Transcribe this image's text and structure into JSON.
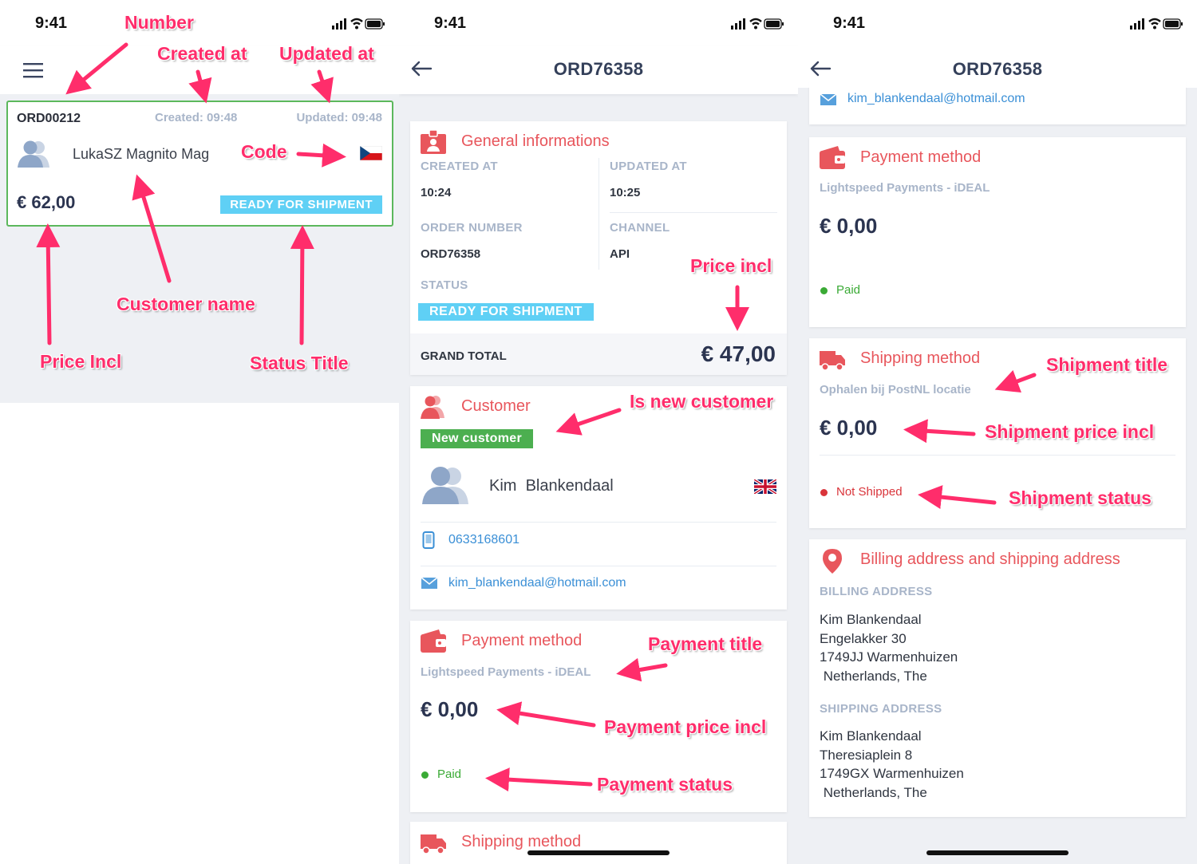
{
  "status_bar": {
    "time": "9:41"
  },
  "screen1": {
    "order_card": {
      "number": "ORD00212",
      "created": "Created: 09:48",
      "updated": "Updated: 09:48",
      "customer_name": "LukaSZ Magnito Mag",
      "price": "€ 62,00",
      "status": "READY FOR SHIPMENT"
    }
  },
  "screen2": {
    "title": "ORD76358",
    "general": {
      "title": "General informations",
      "created_label": "CREATED AT",
      "created_value": "10:24",
      "updated_label": "UPDATED AT",
      "updated_value": "10:25",
      "order_number_label": "ORDER NUMBER",
      "order_number_value": "ORD76358",
      "channel_label": "CHANNEL",
      "channel_value": "API",
      "status_label": "STATUS",
      "status_value": "READY FOR SHIPMENT",
      "grand_total_label": "GRAND TOTAL",
      "grand_total_value": "€ 47,00"
    },
    "customer": {
      "title": "Customer",
      "new_badge": "New customer",
      "first_name": "Kim",
      "last_name": "Blankendaal",
      "phone": "0633168601",
      "email": "kim_blankendaal@hotmail.com"
    },
    "payment": {
      "title": "Payment method",
      "provider": "Lightspeed Payments - iDEAL",
      "price": "€ 0,00",
      "status": "Paid"
    },
    "shipping": {
      "title": "Shipping method"
    }
  },
  "screen3": {
    "title": "ORD76358",
    "email": "kim_blankendaal@hotmail.com",
    "payment": {
      "title": "Payment method",
      "provider": "Lightspeed Payments - iDEAL",
      "price": "€ 0,00",
      "status": "Paid"
    },
    "shipping": {
      "title": "Shipping method",
      "provider": "Ophalen bij PostNL locatie",
      "price": "€ 0,00",
      "status": "Not Shipped"
    },
    "address": {
      "title": "Billing address and shipping address",
      "billing_label": "BILLING ADDRESS",
      "billing_lines": "Kim Blankendaal\nEngelakker 30\n1749JJ Warmenhuizen\n Netherlands, The",
      "shipping_label": "SHIPPING ADDRESS",
      "shipping_lines": "Kim Blankendaal\nTheresiaplein 8\n1749GX Warmenhuizen\n Netherlands, The"
    }
  },
  "annotations": {
    "number": "Number",
    "created_at": "Created at",
    "updated_at": "Updated at",
    "code": "Code",
    "customer_name": "Customer name",
    "price_incl_1": "Price Incl",
    "status_title": "Status Title",
    "price_incl_2": "Price incl",
    "is_new_customer": "Is new customer",
    "payment_title": "Payment title",
    "payment_price_incl": "Payment price incl",
    "payment_status": "Payment status",
    "shipment_title": "Shipment title",
    "shipment_price_incl": "Shipment price incl",
    "shipment_status": "Shipment status"
  },
  "colors": {
    "accent_red": "#e8565c",
    "status_blue": "#5fd0f5",
    "new_green": "#4caf50",
    "paid_green": "#3aaa35",
    "not_shipped_red": "#d9343a",
    "annotation_pink": "#ff2d6b",
    "selected_border": "#5cb85c"
  },
  "icons": [
    "menu-icon",
    "back-icon",
    "signal-icon",
    "wifi-icon",
    "battery-icon",
    "avatar-icon",
    "flag-cz-icon",
    "flag-uk-icon",
    "id-card-icon",
    "customer-icon",
    "phone-icon",
    "mail-icon",
    "wallet-icon",
    "truck-icon",
    "location-pin-icon"
  ]
}
